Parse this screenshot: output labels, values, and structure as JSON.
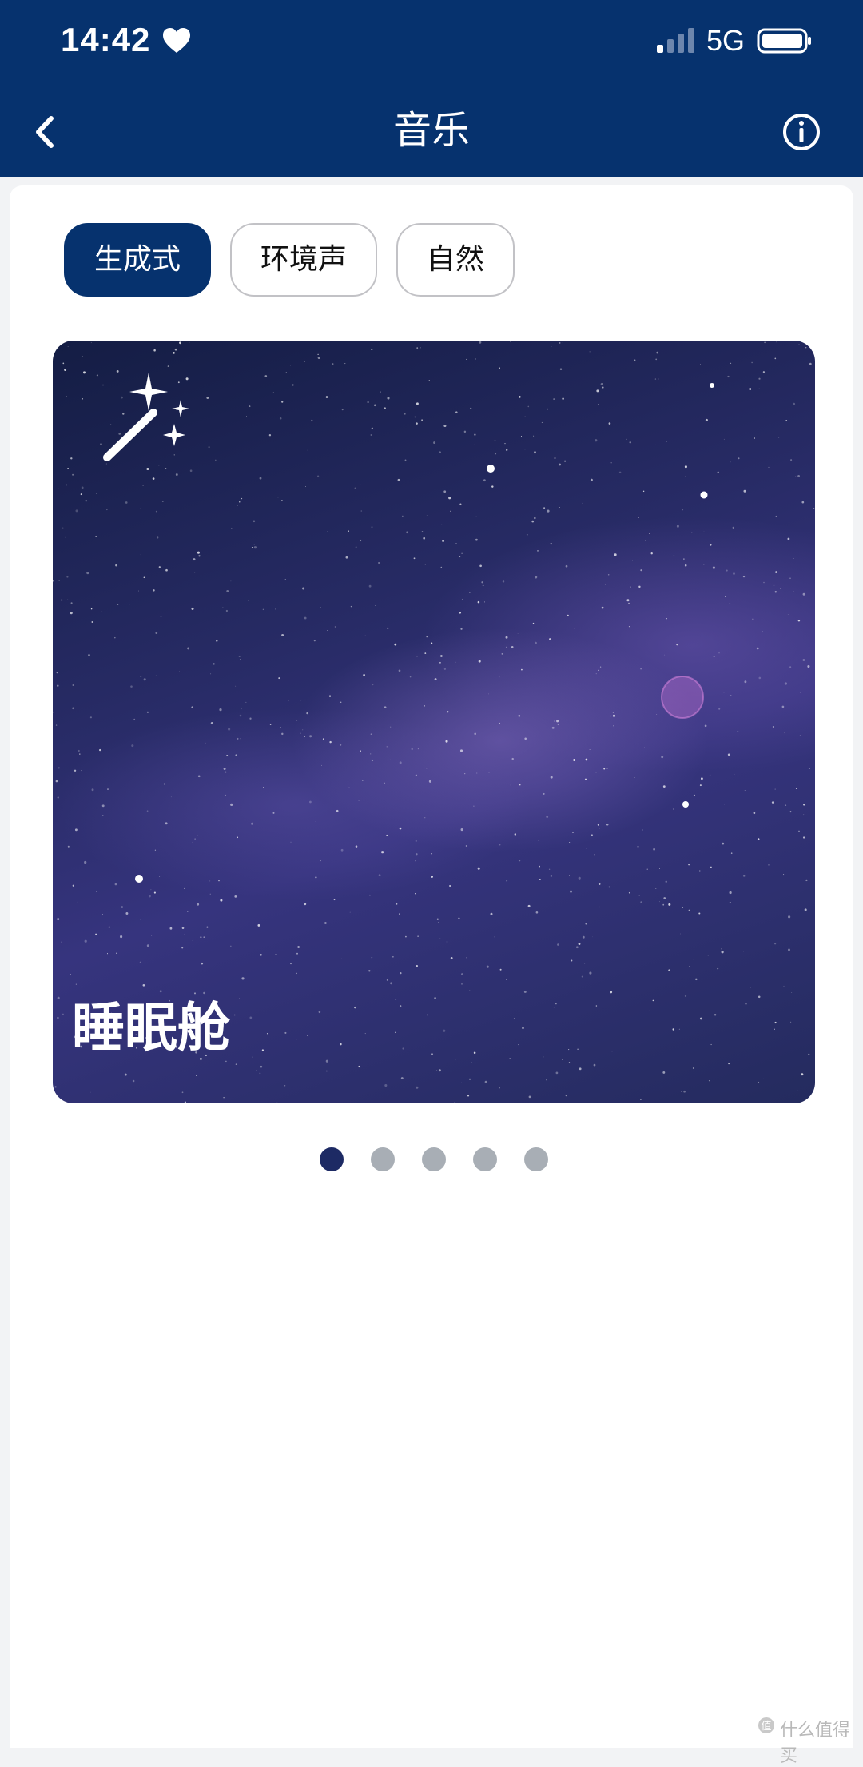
{
  "status_bar": {
    "time": "14:42",
    "network": "5G",
    "icons": [
      "heart-icon",
      "signal-icon",
      "battery-icon"
    ]
  },
  "header": {
    "title": "音乐",
    "back_icon": "chevron-left-icon",
    "info_icon": "info-circle-icon"
  },
  "tabs": [
    {
      "label": "生成式",
      "active": true
    },
    {
      "label": "环境声",
      "active": false
    },
    {
      "label": "自然",
      "active": false
    }
  ],
  "carousel": {
    "current_title": "睡眠舱",
    "badge_icon": "magic-wand-icon",
    "page_count": 5,
    "active_index": 0
  },
  "watermark": "什么值得买",
  "colors": {
    "header": "#06326e",
    "active_tab": "#06326e",
    "active_dot": "#1d2a64",
    "inactive_dot": "#a8aeb5"
  }
}
